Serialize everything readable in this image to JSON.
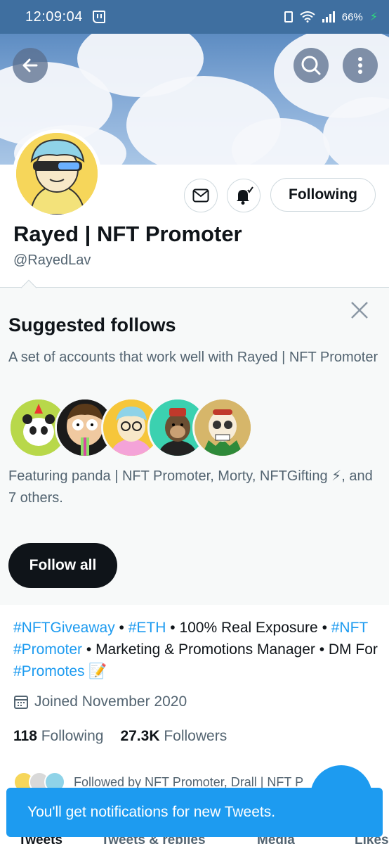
{
  "status_bar": {
    "time": "12:09:04",
    "battery": "66%",
    "bolt": "ϟ"
  },
  "header": {
    "back_icon": "arrow-left-icon",
    "search_icon": "search-icon",
    "more_icon": "more-vertical-icon"
  },
  "profile": {
    "display_name": "Rayed | NFT Promoter",
    "handle": "@RayedLav",
    "following_button": "Following",
    "message_icon": "mail-icon",
    "notify_icon": "bell-active-icon"
  },
  "suggested": {
    "title": "Suggested follows",
    "subtitle": "A set of accounts that work well with Rayed | NFT Promoter",
    "featuring": "Featuring panda | NFT Promoter, Morty, NFTGifting ⚡, and 7 others.",
    "follow_all": "Follow all"
  },
  "bio": {
    "tag1": "#NFTGiveaway",
    "sep1": " • ",
    "tag2": "#ETH",
    "text1": " • 100% Real Exposure • ",
    "tag3": "#NFT",
    "space1": " ",
    "tag4": "#Promoter",
    "text2": " • Marketing & Promotions Manager • DM For ",
    "tag5": "#Promotes",
    "emoji": " 📝"
  },
  "joined": "Joined November 2020",
  "stats": {
    "following_count": "118",
    "following_label": "Following",
    "followers_count": "27.3K",
    "followers_label": "Followers"
  },
  "followed_by": "Followed by NFT Promoter, Drall | NFT P",
  "tabs": [
    "Tweets",
    "Tweets & replies",
    "Media",
    "Likes"
  ],
  "toast": "You'll get notifications for new Tweets.",
  "colors": {
    "accent": "#1d9bf0",
    "status_bar": "#3f6fa0",
    "text": "#0f1419",
    "muted": "#536471"
  }
}
